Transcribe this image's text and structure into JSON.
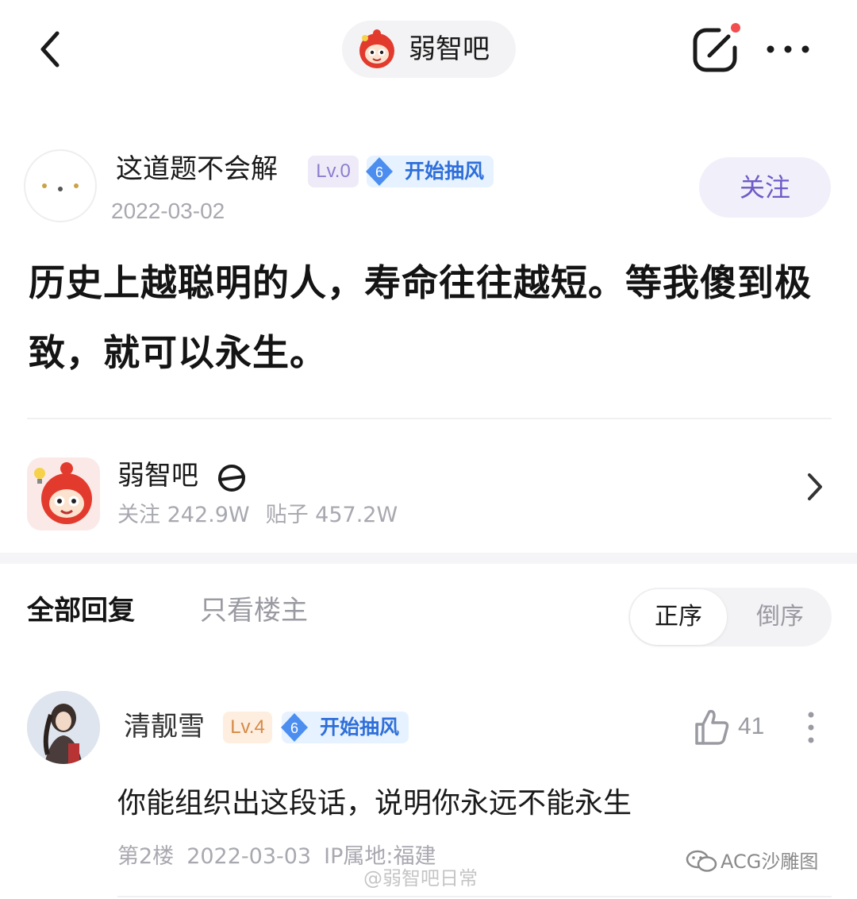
{
  "header": {
    "forum_name": "弱智吧",
    "icons": {
      "back": "back-arrow-icon",
      "forum_avatar": "forum-mascot-icon",
      "edit": "edit-post-icon",
      "more": "more-dots-icon"
    },
    "edit_badge_color": "#f24e4e"
  },
  "post": {
    "author": "这道题不会解",
    "level": "Lv.0",
    "title_level": "6",
    "title": "开始抽风",
    "date": "2022-03-02",
    "follow_label": "关注",
    "content": "历史上越聪明的人，寿命往往越短。等我傻到极致，就可以永生。"
  },
  "forum_card": {
    "name": "弱智吧",
    "followers_label": "关注 242.9W",
    "posts_label": "贴子 457.2W",
    "icons": {
      "tag": "slashed-circle-icon",
      "chevron": "chevron-right-icon"
    }
  },
  "replies": {
    "tab_all": "全部回复",
    "tab_op_only": "只看楼主",
    "sort_asc": "正序",
    "sort_desc": "倒序"
  },
  "comments": [
    {
      "author": "清靓雪",
      "level": "Lv.4",
      "title_level": "6",
      "title": "开始抽风",
      "likes": "41",
      "text": "你能组织出这段话，说明你永远不能永生",
      "floor": "第2楼",
      "date": "2022-03-03",
      "ip": "IP属地:福建"
    }
  ],
  "watermarks": {
    "center": "@弱智吧日常",
    "right": "ACG沙雕图"
  },
  "colors": {
    "accent_purple": "#6e5bc6",
    "title_badge_blue": "#2f6fd9",
    "muted_gray": "#a8a8b0"
  }
}
